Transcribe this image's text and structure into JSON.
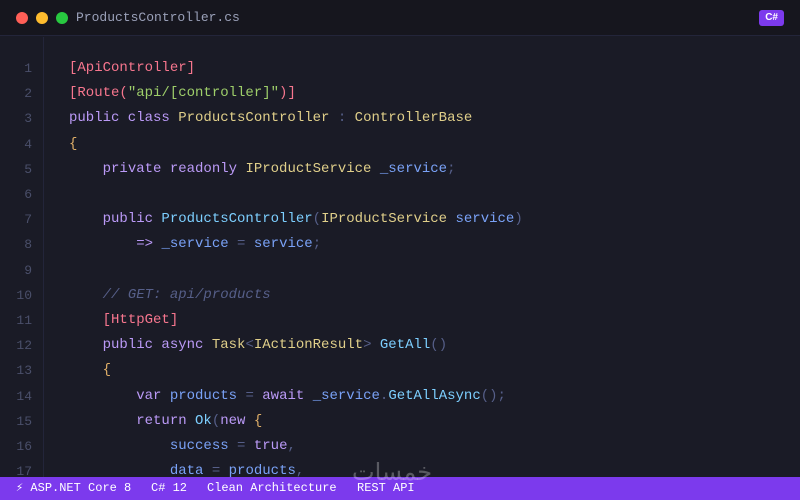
{
  "window": {
    "filename": "ProductsController.cs",
    "language_badge": "C#"
  },
  "colors": {
    "accent": "#7c3aed",
    "background": "#1a1b26",
    "attribute": "#f7768e",
    "string": "#9ece6a",
    "keyword": "#bb9af7",
    "type": "#e0cf8a",
    "function": "#7dcfff",
    "variable": "#7aa2f7",
    "comment": "#565f89"
  },
  "code": {
    "lines": [
      {
        "n": "1",
        "tokens": [
          [
            "attr",
            "[ApiController]"
          ]
        ]
      },
      {
        "n": "2",
        "tokens": [
          [
            "attr",
            "[Route("
          ],
          [
            "str",
            "\"api/[controller]\""
          ],
          [
            "attr",
            ")]"
          ]
        ]
      },
      {
        "n": "3",
        "tokens": [
          [
            "kw",
            "public class "
          ],
          [
            "type",
            "ProductsController"
          ],
          [
            "punct",
            " : "
          ],
          [
            "type",
            "ControllerBase"
          ]
        ]
      },
      {
        "n": "4",
        "tokens": [
          [
            "brace",
            "{"
          ]
        ]
      },
      {
        "n": "5",
        "tokens": [
          [
            "plain",
            "    "
          ],
          [
            "kw",
            "private readonly "
          ],
          [
            "type",
            "IProductService"
          ],
          [
            "plain",
            " "
          ],
          [
            "var",
            "_service"
          ],
          [
            "punct",
            ";"
          ]
        ]
      },
      {
        "n": "6",
        "tokens": []
      },
      {
        "n": "7",
        "tokens": [
          [
            "plain",
            "    "
          ],
          [
            "kw",
            "public "
          ],
          [
            "fn",
            "ProductsController"
          ],
          [
            "punct",
            "("
          ],
          [
            "type",
            "IProductService"
          ],
          [
            "plain",
            " "
          ],
          [
            "var",
            "service"
          ],
          [
            "punct",
            ")"
          ]
        ]
      },
      {
        "n": "8",
        "tokens": [
          [
            "plain",
            "        "
          ],
          [
            "kw",
            "=> "
          ],
          [
            "var",
            "_service"
          ],
          [
            "punct",
            " = "
          ],
          [
            "var",
            "service"
          ],
          [
            "punct",
            ";"
          ]
        ]
      },
      {
        "n": "9",
        "tokens": []
      },
      {
        "n": "10",
        "tokens": [
          [
            "plain",
            "    "
          ],
          [
            "com",
            "// GET: api/products"
          ]
        ]
      },
      {
        "n": "11",
        "tokens": [
          [
            "plain",
            "    "
          ],
          [
            "attr",
            "[HttpGet]"
          ]
        ]
      },
      {
        "n": "12",
        "tokens": [
          [
            "plain",
            "    "
          ],
          [
            "kw",
            "public async "
          ],
          [
            "type",
            "Task"
          ],
          [
            "punct",
            "<"
          ],
          [
            "type",
            "IActionResult"
          ],
          [
            "punct",
            "> "
          ],
          [
            "fn",
            "GetAll"
          ],
          [
            "punct",
            "()"
          ]
        ]
      },
      {
        "n": "13",
        "tokens": [
          [
            "plain",
            "    "
          ],
          [
            "brace",
            "{"
          ]
        ]
      },
      {
        "n": "14",
        "tokens": [
          [
            "plain",
            "        "
          ],
          [
            "kw",
            "var "
          ],
          [
            "var",
            "products"
          ],
          [
            "punct",
            " = "
          ],
          [
            "kw",
            "await "
          ],
          [
            "var",
            "_service"
          ],
          [
            "punct",
            "."
          ],
          [
            "fn",
            "GetAllAsync"
          ],
          [
            "punct",
            "();"
          ]
        ]
      },
      {
        "n": "15",
        "tokens": [
          [
            "plain",
            "        "
          ],
          [
            "kw",
            "return "
          ],
          [
            "fn",
            "Ok"
          ],
          [
            "punct",
            "("
          ],
          [
            "kw",
            "new "
          ],
          [
            "brace",
            "{"
          ]
        ]
      },
      {
        "n": "16",
        "tokens": [
          [
            "plain",
            "            "
          ],
          [
            "var",
            "success"
          ],
          [
            "punct",
            " = "
          ],
          [
            "kw",
            "true"
          ],
          [
            "punct",
            ","
          ]
        ]
      },
      {
        "n": "17",
        "tokens": [
          [
            "plain",
            "            "
          ],
          [
            "var",
            "data"
          ],
          [
            "punct",
            " = "
          ],
          [
            "var",
            "products"
          ],
          [
            "punct",
            ","
          ]
        ]
      }
    ]
  },
  "statusbar": {
    "framework": "⚡ ASP.NET Core 8",
    "language_version": "C# 12",
    "architecture": "Clean Architecture",
    "api_type": "REST API"
  },
  "watermark": "ﺧﻤﺴﺎﺕ"
}
